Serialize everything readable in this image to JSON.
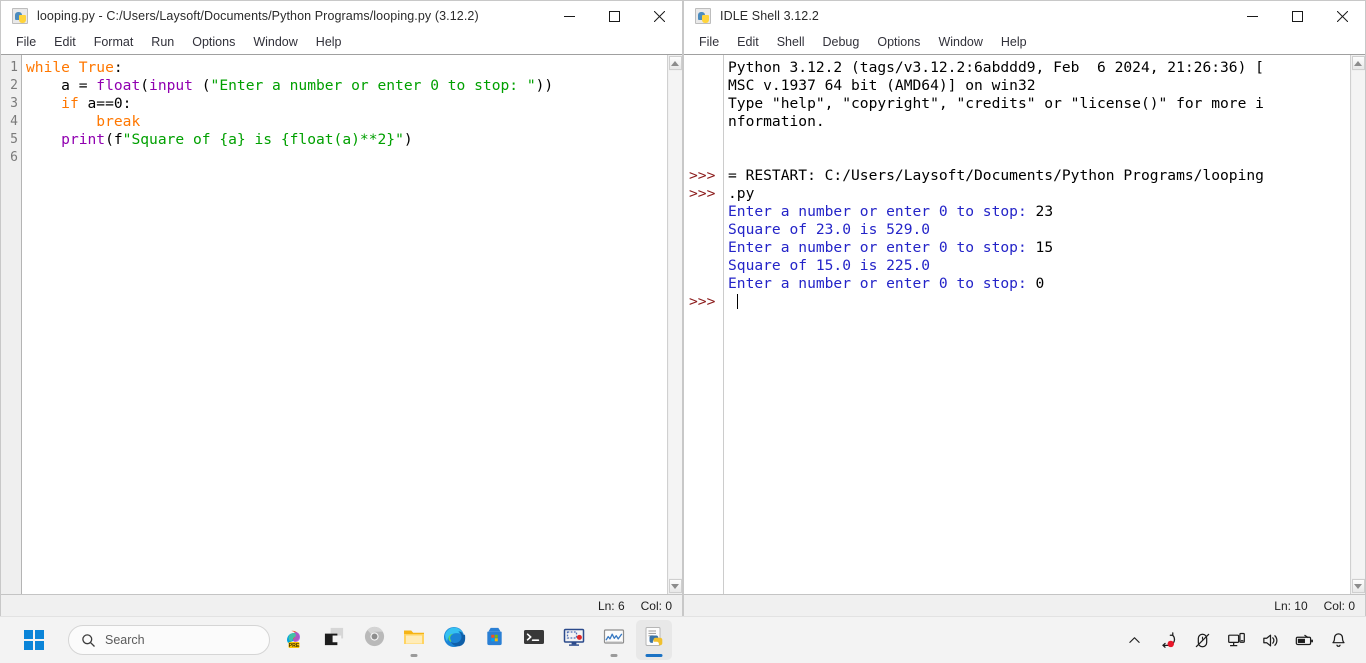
{
  "editor_window": {
    "title": "looping.py - C:/Users/Laysoft/Documents/Python Programs/looping.py (3.12.2)",
    "icon": "python-file-icon",
    "menu": [
      "File",
      "Edit",
      "Format",
      "Run",
      "Options",
      "Window",
      "Help"
    ],
    "window_controls": {
      "minimize": "—",
      "maximize": "□",
      "close": "✕"
    },
    "line_numbers": [
      "1",
      "2",
      "3",
      "4",
      "5",
      "6"
    ],
    "code_lines": [
      [
        {
          "t": "while",
          "c": "kw"
        },
        {
          "t": " ",
          "c": "plain"
        },
        {
          "t": "True",
          "c": "kw"
        },
        {
          "t": ":",
          "c": "plain"
        }
      ],
      [
        {
          "t": "    a = ",
          "c": "plain"
        },
        {
          "t": "float",
          "c": "builtin"
        },
        {
          "t": "(",
          "c": "plain"
        },
        {
          "t": "input",
          "c": "builtin"
        },
        {
          "t": " (",
          "c": "plain"
        },
        {
          "t": "\"Enter a number or enter 0 to stop: \"",
          "c": "str"
        },
        {
          "t": "))",
          "c": "plain"
        }
      ],
      [
        {
          "t": "    ",
          "c": "plain"
        },
        {
          "t": "if",
          "c": "kw"
        },
        {
          "t": " a==0:",
          "c": "plain"
        }
      ],
      [
        {
          "t": "        ",
          "c": "plain"
        },
        {
          "t": "break",
          "c": "kw"
        }
      ],
      [
        {
          "t": "    ",
          "c": "plain"
        },
        {
          "t": "print",
          "c": "builtin"
        },
        {
          "t": "(f",
          "c": "plain"
        },
        {
          "t": "\"Square of ",
          "c": "str"
        },
        {
          "t": "{a}",
          "c": "str"
        },
        {
          "t": " is ",
          "c": "str"
        },
        {
          "t": "{float(a)**2}",
          "c": "str"
        },
        {
          "t": "\"",
          "c": "str"
        },
        {
          "t": ")",
          "c": "plain"
        }
      ],
      []
    ],
    "status": {
      "line_label": "Ln: 6",
      "col_label": "Col: 0"
    }
  },
  "shell_window": {
    "title": "IDLE Shell 3.12.2",
    "icon": "python-file-icon",
    "menu": [
      "File",
      "Edit",
      "Shell",
      "Debug",
      "Options",
      "Window",
      "Help"
    ],
    "window_controls": {
      "minimize": "—",
      "maximize": "□",
      "close": "✕"
    },
    "prompt_symbol": ">>>",
    "prompt_rows": [
      7,
      14
    ],
    "output_lines": [
      {
        "text": "Python 3.12.2 (tags/v3.12.2:6abddd9, Feb  6 2024, 21:26:36) [",
        "color": "black"
      },
      {
        "text": "MSC v.1937 64 bit (AMD64)] on win32",
        "color": "black"
      },
      {
        "text": "Type \"help\", \"copyright\", \"credits\" or \"license()\" for more i",
        "color": "black"
      },
      {
        "text": "nformation.",
        "color": "black"
      },
      {
        "text": "",
        "color": "black"
      },
      {
        "text": "",
        "color": "black"
      },
      {
        "text": "= RESTART: C:/Users/Laysoft/Documents/Python Programs/looping",
        "color": "black"
      },
      {
        "text": ".py",
        "color": "black"
      },
      {
        "parts": [
          {
            "t": "Enter a number or enter 0 to stop: ",
            "c": "blue"
          },
          {
            "t": "23",
            "c": "black"
          }
        ]
      },
      {
        "text": "Square of 23.0 is 529.0",
        "color": "blue"
      },
      {
        "parts": [
          {
            "t": "Enter a number or enter 0 to stop: ",
            "c": "blue"
          },
          {
            "t": "15",
            "c": "black"
          }
        ]
      },
      {
        "text": "Square of 15.0 is 225.0",
        "color": "blue"
      },
      {
        "parts": [
          {
            "t": "Enter a number or enter 0 to stop: ",
            "c": "blue"
          },
          {
            "t": "0",
            "c": "black"
          }
        ]
      },
      {
        "text": "",
        "color": "black",
        "caret": true
      }
    ],
    "status": {
      "line_label": "Ln: 10",
      "col_label": "Col: 0"
    }
  },
  "taskbar": {
    "start_label": "start-button",
    "search": {
      "placeholder": "Search",
      "icon": "search-icon"
    },
    "apps": [
      {
        "name": "copilot-preview-icon",
        "badge": "PRE",
        "running": false
      },
      {
        "name": "task-view-icon",
        "running": false
      },
      {
        "name": "chrome-icon",
        "running": false
      },
      {
        "name": "file-explorer-icon",
        "running": true
      },
      {
        "name": "microsoft-edge-icon",
        "running": false
      },
      {
        "name": "microsoft-store-icon",
        "running": false
      },
      {
        "name": "terminal-icon",
        "running": false
      },
      {
        "name": "snipping-tool-icon",
        "running": false
      },
      {
        "name": "task-manager-icon",
        "running": true
      },
      {
        "name": "python-idle-icon",
        "running": true,
        "active": true
      }
    ],
    "tray": [
      {
        "name": "show-hidden-icons-chevron"
      },
      {
        "name": "onedrive-sync-icon"
      },
      {
        "name": "mouse-disabled-icon"
      },
      {
        "name": "network-icon"
      },
      {
        "name": "volume-icon"
      },
      {
        "name": "battery-icon"
      },
      {
        "name": "notifications-bell-icon"
      }
    ]
  },
  "colors": {
    "keyword": "#ff7700",
    "builtin": "#9000b0",
    "string": "#00a000",
    "shell_output": "#2424c8",
    "prompt": "#8b1a1a",
    "accent": "#0a84d8"
  }
}
